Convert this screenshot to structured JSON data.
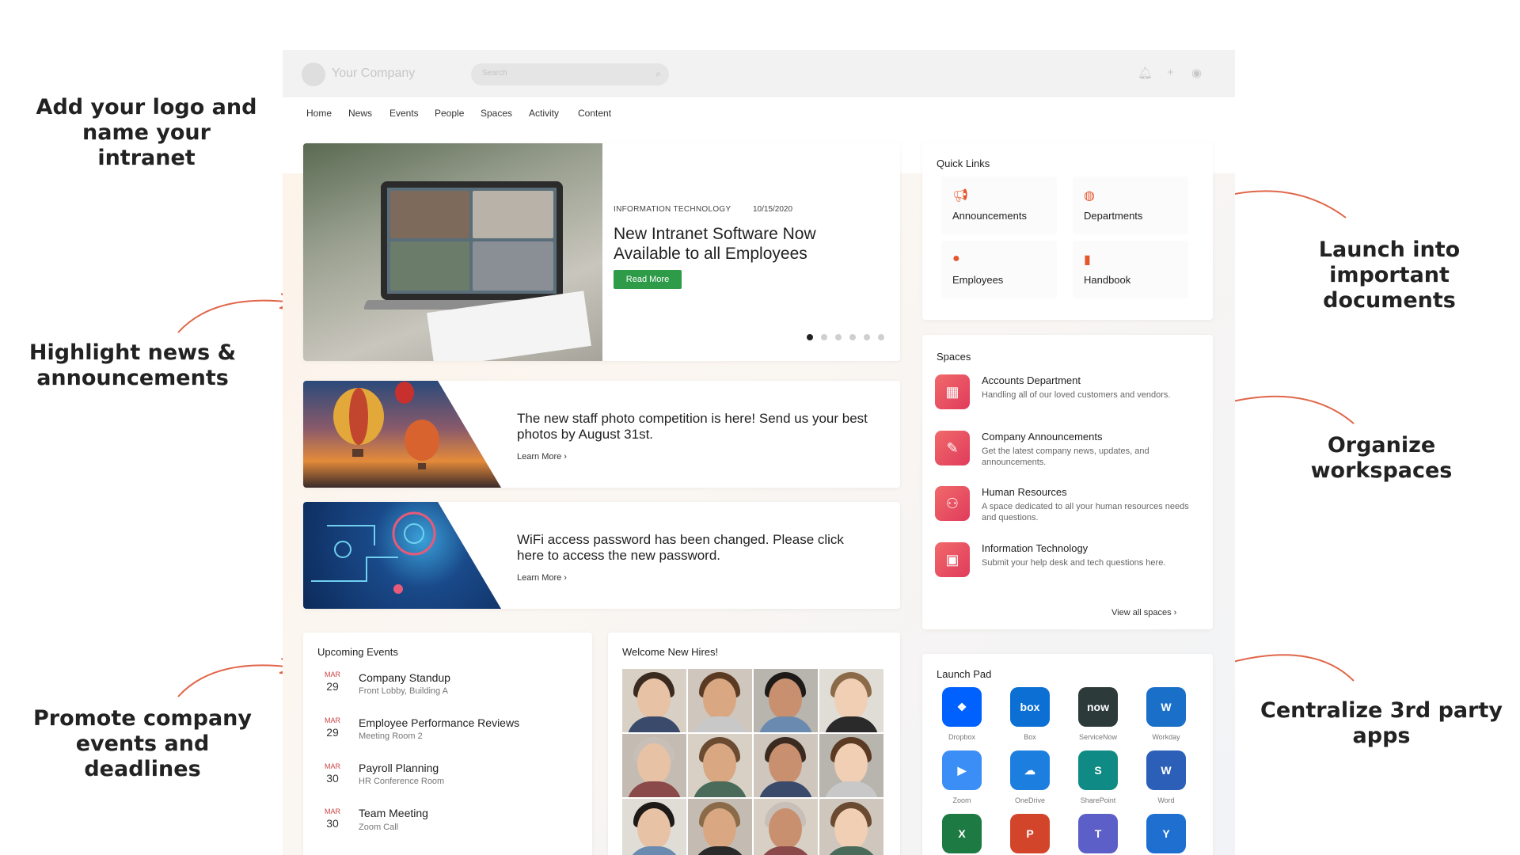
{
  "callouts": {
    "logo": [
      "Add your logo and",
      "name your intranet"
    ],
    "news": [
      "Highlight news &",
      "announcements"
    ],
    "events": [
      "Promote company",
      "events and deadlines"
    ],
    "launch": [
      "Launch into important",
      "documents"
    ],
    "organize": [
      "Organize workspaces"
    ],
    "apps": [
      "Centralize 3rd party",
      "apps"
    ]
  },
  "colors": {
    "accent": "#e4572e",
    "button_green": "#2e9b48",
    "arrow": "#e0664a"
  },
  "topbar": {
    "company": "Your Company",
    "search_placeholder": "Search",
    "icons": [
      "bell-icon",
      "plus-icon",
      "user-icon"
    ]
  },
  "nav": [
    "Home",
    "News",
    "Events",
    "People",
    "Spaces",
    "Activity",
    "Content"
  ],
  "hero": {
    "category": "INFORMATION TECHNOLOGY",
    "date": "10/15/2020",
    "title": "New Intranet Software Now Available to all Employees",
    "button": "Read More",
    "slide_count": 6,
    "active_slide": 1
  },
  "news": [
    {
      "text": "The new staff photo competition is here! Send us your best photos by August 31st.",
      "link": "Learn More ›"
    },
    {
      "text": "WiFi access password has been changed. Please click here to access the new password.",
      "link": "Learn More ›"
    }
  ],
  "quick_links": {
    "title": "Quick Links",
    "items": [
      {
        "label": "Announcements",
        "icon": "megaphone-icon"
      },
      {
        "label": "Departments",
        "icon": "globe-icon"
      },
      {
        "label": "Employees",
        "icon": "person-icon"
      },
      {
        "label": "Handbook",
        "icon": "book-icon"
      }
    ]
  },
  "spaces": {
    "title": "Spaces",
    "items": [
      {
        "title": "Accounts Department",
        "desc": "Handling all of our loved customers and vendors.",
        "icon": "calculator-icon"
      },
      {
        "title": "Company Announcements",
        "desc": "Get the latest company news, updates, and announcements.",
        "icon": "pen-icon"
      },
      {
        "title": "Human Resources",
        "desc": "A space dedicated to all your human resources needs and questions.",
        "icon": "people-icon"
      },
      {
        "title": "Information Technology",
        "desc": "Submit your help desk and tech questions here.",
        "icon": "computer-icon"
      }
    ],
    "view_all": "View all spaces ›"
  },
  "events": {
    "title": "Upcoming Events",
    "items": [
      {
        "month": "MAR",
        "day": "29",
        "title": "Company Standup",
        "location": "Front Lobby, Building A"
      },
      {
        "month": "MAR",
        "day": "29",
        "title": "Employee Performance Reviews",
        "location": "Meeting Room 2"
      },
      {
        "month": "MAR",
        "day": "30",
        "title": "Payroll Planning",
        "location": "HR Conference Room"
      },
      {
        "month": "MAR",
        "day": "30",
        "title": "Team Meeting",
        "location": "Zoom Call"
      }
    ]
  },
  "new_hires": {
    "title": "Welcome New Hires!"
  },
  "launch_pad": {
    "title": "Launch Pad",
    "apps": [
      {
        "label": "Dropbox",
        "glyph": "❖",
        "color": "#0061fe"
      },
      {
        "label": "Box",
        "glyph": "box",
        "color": "#0b6fd4"
      },
      {
        "label": "ServiceNow",
        "glyph": "now",
        "color": "#2d3a3a"
      },
      {
        "label": "Workday",
        "glyph": "W",
        "color": "#1a6fc9"
      },
      {
        "label": "Zoom",
        "glyph": "▶",
        "color": "#3b8ef5"
      },
      {
        "label": "OneDrive",
        "glyph": "☁",
        "color": "#1c7fe0"
      },
      {
        "label": "SharePoint",
        "glyph": "S",
        "color": "#0f8a84"
      },
      {
        "label": "Word",
        "glyph": "W",
        "color": "#2b5fb8"
      },
      {
        "label": "",
        "glyph": "X",
        "color": "#1e7a43"
      },
      {
        "label": "",
        "glyph": "P",
        "color": "#d2452a"
      },
      {
        "label": "",
        "glyph": "T",
        "color": "#5b5fc7"
      },
      {
        "label": "",
        "glyph": "Y",
        "color": "#1f6fd1"
      }
    ]
  }
}
